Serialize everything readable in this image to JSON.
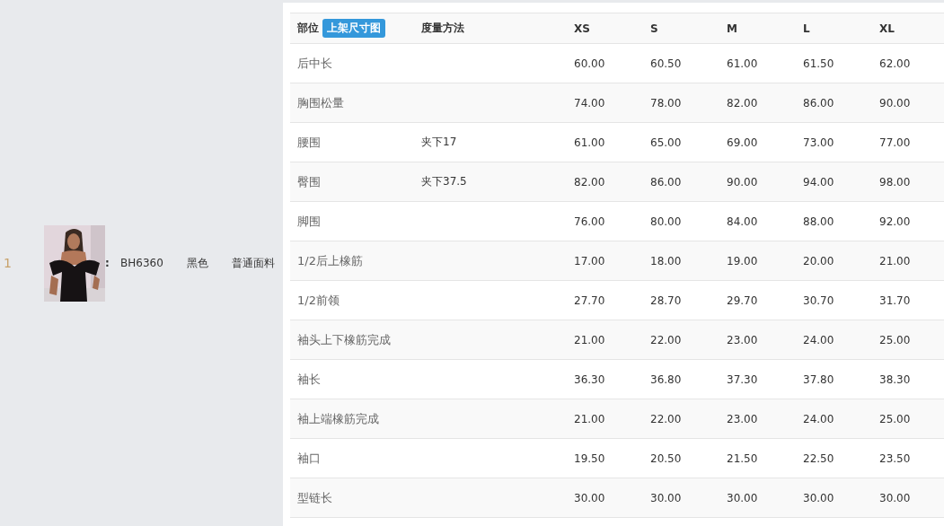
{
  "product": {
    "index": "1",
    "colon": ":",
    "code": "BH6360",
    "color_name": "黑色",
    "fabric": "普通面料"
  },
  "size_table": {
    "columns": [
      {
        "label": "部位",
        "badge": "上架尺寸图"
      },
      {
        "label": "度量方法"
      },
      {
        "label": "XS"
      },
      {
        "label": "S"
      },
      {
        "label": "M"
      },
      {
        "label": "L"
      },
      {
        "label": "XL"
      }
    ],
    "rows": [
      {
        "part": "后中长",
        "method": "",
        "values": [
          "60.00",
          "60.50",
          "61.00",
          "61.50",
          "62.00"
        ]
      },
      {
        "part": "胸围松量",
        "method": "",
        "values": [
          "74.00",
          "78.00",
          "82.00",
          "86.00",
          "90.00"
        ]
      },
      {
        "part": "腰围",
        "method": "夹下17",
        "values": [
          "61.00",
          "65.00",
          "69.00",
          "73.00",
          "77.00"
        ]
      },
      {
        "part": "臀围",
        "method": "夹下37.5",
        "values": [
          "82.00",
          "86.00",
          "90.00",
          "94.00",
          "98.00"
        ]
      },
      {
        "part": "脚围",
        "method": "",
        "values": [
          "76.00",
          "80.00",
          "84.00",
          "88.00",
          "92.00"
        ]
      },
      {
        "part": "1/2后上橡筋",
        "method": "",
        "values": [
          "17.00",
          "18.00",
          "19.00",
          "20.00",
          "21.00"
        ]
      },
      {
        "part": "1/2前领",
        "method": "",
        "values": [
          "27.70",
          "28.70",
          "29.70",
          "30.70",
          "31.70"
        ]
      },
      {
        "part": "袖头上下橡筋完成",
        "method": "",
        "values": [
          "21.00",
          "22.00",
          "23.00",
          "24.00",
          "25.00"
        ]
      },
      {
        "part": "袖长",
        "method": "",
        "values": [
          "36.30",
          "36.80",
          "37.30",
          "37.80",
          "38.30"
        ]
      },
      {
        "part": "袖上端橡筋完成",
        "method": "",
        "values": [
          "21.00",
          "22.00",
          "23.00",
          "24.00",
          "25.00"
        ]
      },
      {
        "part": "袖口",
        "method": "",
        "values": [
          "19.50",
          "20.50",
          "21.50",
          "22.50",
          "23.50"
        ]
      },
      {
        "part": "型链长",
        "method": "",
        "values": [
          "30.00",
          "30.00",
          "30.00",
          "30.00",
          "30.00"
        ]
      }
    ]
  }
}
